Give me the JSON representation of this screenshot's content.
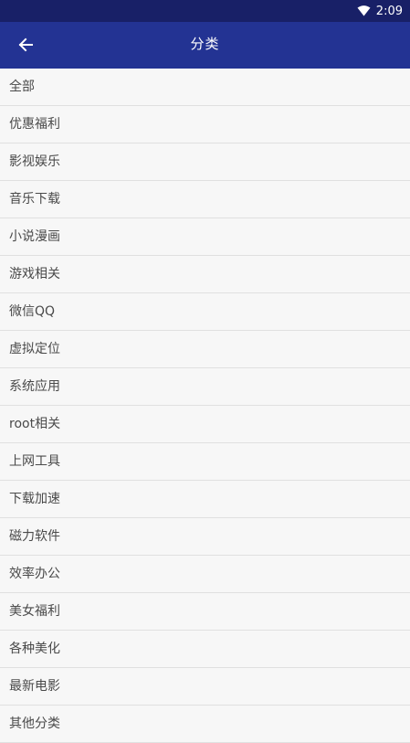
{
  "status_bar": {
    "time": "2:09",
    "icons": [
      "wifi-icon"
    ],
    "background": "#182067"
  },
  "app_bar": {
    "title": "分类",
    "back_icon": "arrow-left-icon",
    "background": "#233393"
  },
  "categories": [
    {
      "label": "全部"
    },
    {
      "label": "优惠福利"
    },
    {
      "label": "影视娱乐"
    },
    {
      "label": "音乐下载"
    },
    {
      "label": "小说漫画"
    },
    {
      "label": "游戏相关"
    },
    {
      "label": "微信QQ"
    },
    {
      "label": "虚拟定位"
    },
    {
      "label": "系统应用"
    },
    {
      "label": "root相关"
    },
    {
      "label": "上网工具"
    },
    {
      "label": "下载加速"
    },
    {
      "label": "磁力软件"
    },
    {
      "label": "效率办公"
    },
    {
      "label": "美女福利"
    },
    {
      "label": "各种美化"
    },
    {
      "label": "最新电影"
    },
    {
      "label": "其他分类"
    }
  ]
}
